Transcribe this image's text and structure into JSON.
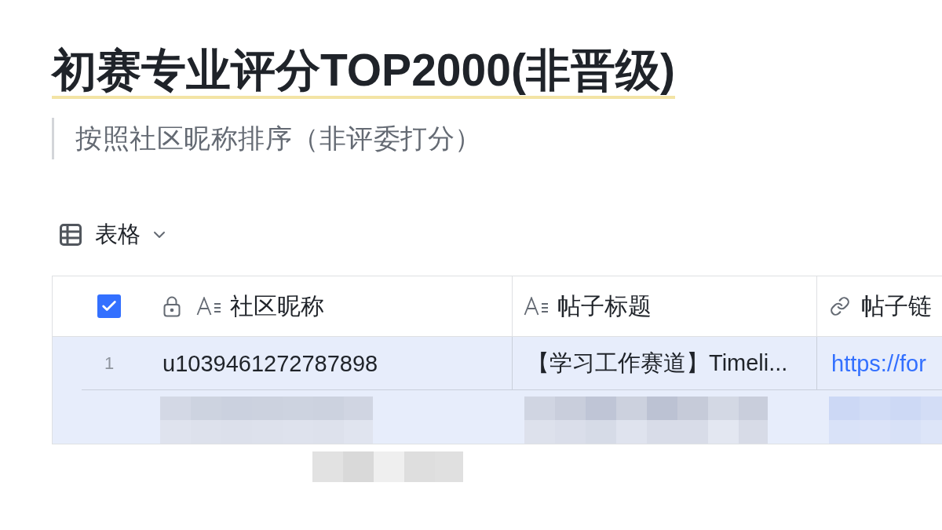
{
  "title": "初赛专业评分TOP2000(非晋级)",
  "quote": "按照社区昵称排序（非评委打分）",
  "view_switcher": {
    "label": "表格"
  },
  "table": {
    "select_all": {
      "checked": true
    },
    "columns": [
      {
        "kind": "text",
        "label": "社区昵称",
        "locked": true
      },
      {
        "kind": "text",
        "label": "帖子标题",
        "locked": false
      },
      {
        "kind": "link",
        "label": "帖子链",
        "locked": false
      }
    ],
    "rows": [
      {
        "kind": "data",
        "selected": true,
        "number": "1",
        "cells": [
          "u1039461272787898",
          "【学习工作赛道】Timeli...",
          "https://for"
        ]
      },
      {
        "kind": "pixelated",
        "selected": true
      }
    ]
  }
}
